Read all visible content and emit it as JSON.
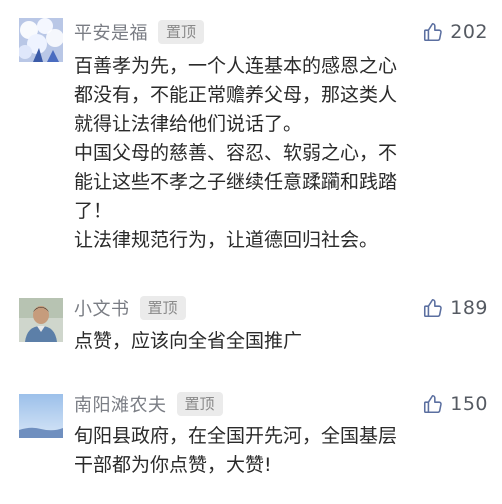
{
  "comments": [
    {
      "username": "平安是福",
      "pin_label": "置顶",
      "likes": "202",
      "text": "百善孝为先，一个人连基本的感恩之心\n都没有，不能正常赡养父母，那这类人\n就得让法律给他们说话了。\n中国父母的慈善、容忍、软弱之心，不\n能让这些不孝之子继续任意蹂躏和践踏\n了！\n让法律规范行为，让道德回归社会。"
    },
    {
      "username": "小文书",
      "pin_label": "置顶",
      "likes": "189",
      "text": "点赞，应该向全省全国推广"
    },
    {
      "username": "南阳滩农夫",
      "pin_label": "置顶",
      "likes": "150",
      "text": "旬阳县政府，在全国开先河，全国基层\n干部都为你点赞，大赞!"
    }
  ],
  "colors": {
    "username": "#7a7d84",
    "badge_bg": "#ebebeb",
    "badge_text": "#8a8a8a",
    "like_icon": "#5b6fa0",
    "body_text": "#2a2a2a"
  },
  "icons": [
    "thumbs-up-icon"
  ]
}
